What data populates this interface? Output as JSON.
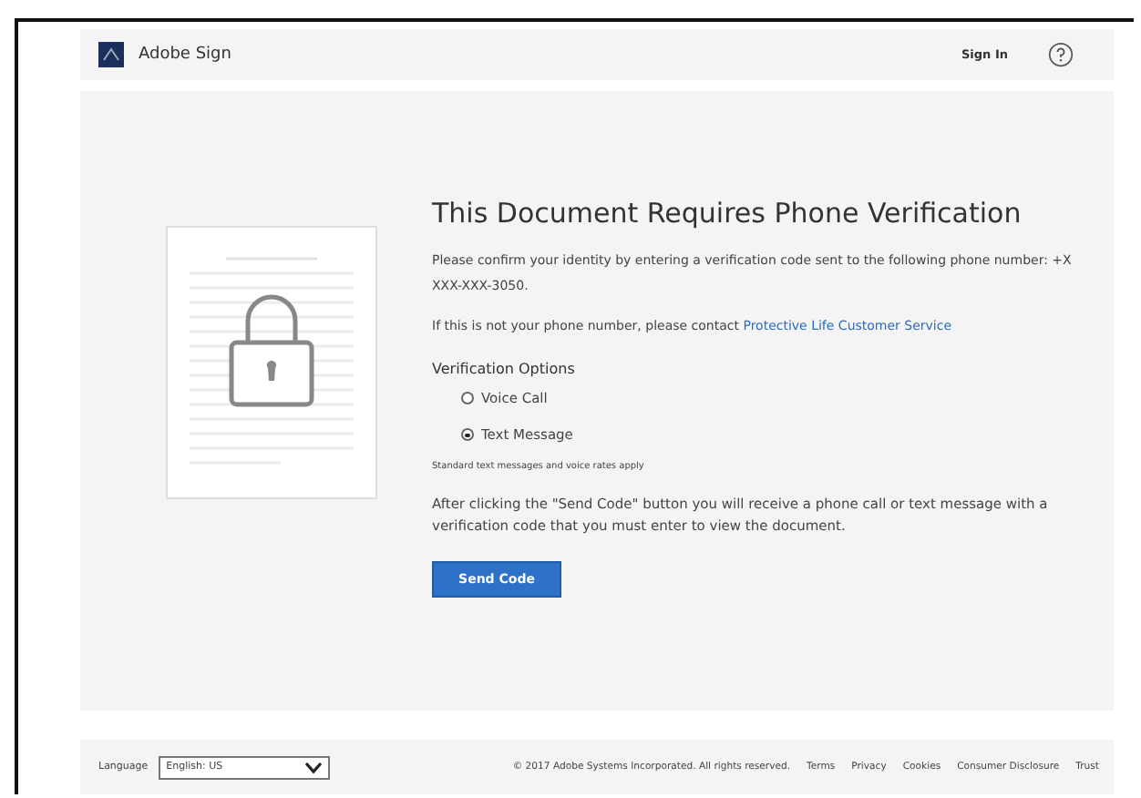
{
  "header": {
    "brand": "Adobe Sign",
    "sign_in": "Sign In"
  },
  "main": {
    "title": "This Document Requires Phone Verification",
    "intro": "Please confirm your identity by entering a verification code sent to the following phone number: +X XXX-XXX-3050.",
    "contact_prefix": "If this is not your phone number, please contact ",
    "contact_link": "Protective Life Customer Service",
    "options_heading": "Verification Options",
    "options": [
      {
        "label": "Voice Call",
        "selected": false
      },
      {
        "label": "Text Message",
        "selected": true
      }
    ],
    "rates_note": "Standard text messages and voice rates apply",
    "instructions": "After clicking the \"Send Code\" button you will receive a phone call or text message with a verification code that you must enter to view the document.",
    "button": "Send Code"
  },
  "footer": {
    "language_label": "Language",
    "language_value": "English: US",
    "copyright": "© 2017 Adobe Systems Incorporated. All rights reserved.",
    "links": [
      "Terms",
      "Privacy",
      "Cookies",
      "Consumer Disclosure",
      "Trust"
    ]
  }
}
